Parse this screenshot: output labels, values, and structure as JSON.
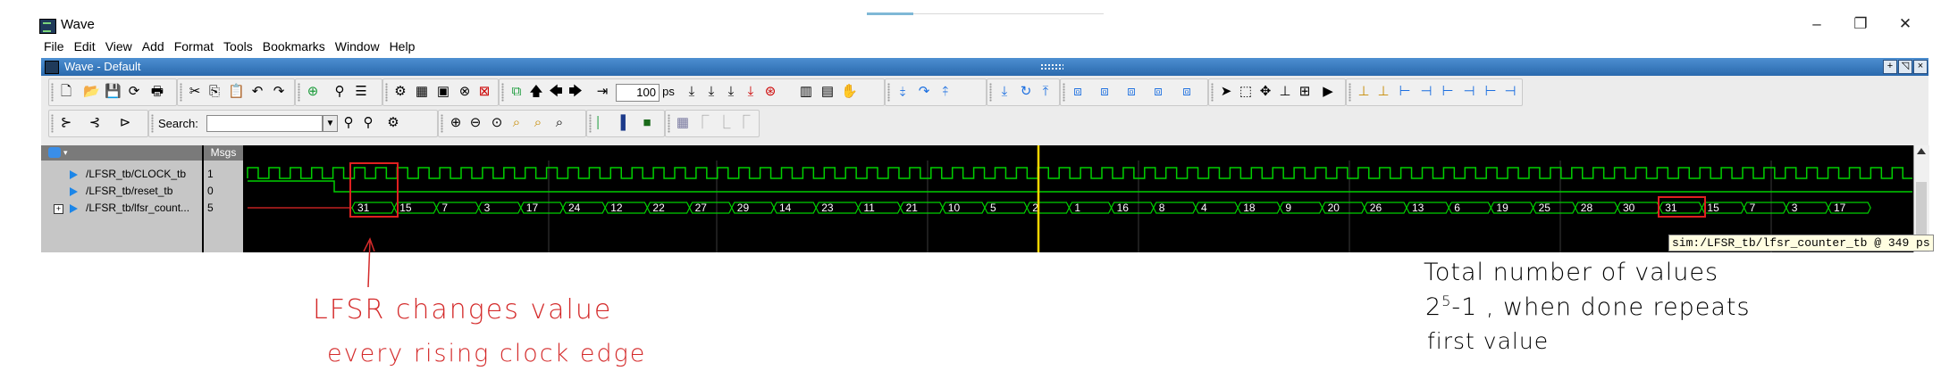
{
  "window": {
    "title": "Wave",
    "icon": "modelsim-wave-icon",
    "controls": [
      "–",
      "❐",
      "✕"
    ]
  },
  "menu": [
    "File",
    "Edit",
    "View",
    "Add",
    "Format",
    "Tools",
    "Bookmarks",
    "Window",
    "Help"
  ],
  "panel": {
    "title": "Wave - Default"
  },
  "toolbar": {
    "zoom_value": "100",
    "zoom_unit": "ps",
    "search_label": "Search:",
    "search_value": ""
  },
  "wave": {
    "msgs_header": "Msgs",
    "signals": [
      {
        "name": "/LFSR_tb/CLOCK_tb",
        "value": "1"
      },
      {
        "name": "/LFSR_tb/reset_tb",
        "value": "0"
      },
      {
        "name": "/LFSR_tb/lfsr_count...",
        "value": "5"
      }
    ],
    "bus_values": [
      "31",
      "15",
      "7",
      "3",
      "17",
      "24",
      "12",
      "22",
      "27",
      "29",
      "14",
      "23",
      "11",
      "21",
      "10",
      "5",
      "2",
      "1",
      "16",
      "8",
      "4",
      "18",
      "9",
      "20",
      "26",
      "13",
      "6",
      "19",
      "25",
      "28",
      "30",
      "31",
      "15",
      "7",
      "3",
      "17"
    ],
    "cursor_label": "sim:/LFSR_tb/lfsr_counter_tb @ 349 ps",
    "colors": {
      "wave": "#00d000",
      "cursor": "#ffd700",
      "highlight": "#e02020"
    }
  },
  "annotations": {
    "left_line1": "LFSR changes value",
    "left_line2": "every rising clock edge",
    "right_line1": "Total number of values",
    "right_line2_base": "2",
    "right_line2_exp": "5",
    "right_line2_rest": "-1 , when done repeats",
    "right_line3": "first value"
  }
}
